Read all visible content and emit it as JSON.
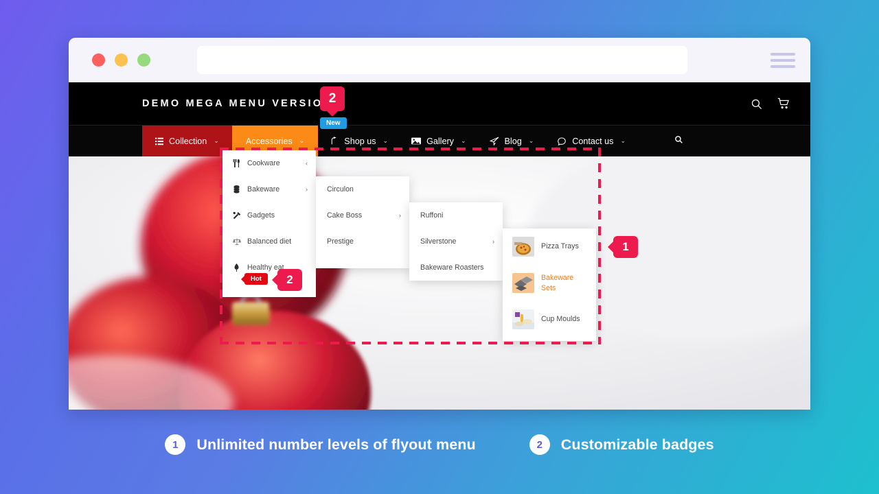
{
  "browser": {
    "traffic_lights": [
      "close-red",
      "minimize-yellow",
      "maximize-green"
    ],
    "url_value": "",
    "url_placeholder": "",
    "menu_icon": "hamburger-icon"
  },
  "site": {
    "logo_text": "DEMO MEGA MENU VERSION 2",
    "header_icons": [
      "search-icon",
      "cart-icon"
    ],
    "nav": [
      {
        "label": "Collection",
        "icon": "list-icon",
        "caret": "⌄",
        "state": "active-red"
      },
      {
        "label": "Accessories",
        "icon": "",
        "caret": "⌄",
        "state": "active-orange"
      },
      {
        "label": "Shop us",
        "icon": "share-icon",
        "caret": "⌄",
        "state": "default"
      },
      {
        "label": "Gallery",
        "icon": "image-icon",
        "caret": "⌄",
        "state": "default"
      },
      {
        "label": "Blog",
        "icon": "paperplane-icon",
        "caret": "⌄",
        "state": "default"
      },
      {
        "label": "Contact us",
        "icon": "comment-icon",
        "caret": "⌄",
        "state": "default"
      }
    ],
    "nav_search_icon": "search-icon"
  },
  "menu": {
    "level1": [
      {
        "label": "Cookware",
        "icon": "cutlery-icon",
        "arrow": "‹"
      },
      {
        "label": "Bakeware",
        "icon": "pans-icon",
        "arrow": "›"
      },
      {
        "label": "Gadgets",
        "icon": "gadgets-icon",
        "arrow": ""
      },
      {
        "label": "Balanced diet",
        "icon": "scales-icon",
        "arrow": ""
      },
      {
        "label": "Healthy eat",
        "icon": "leaf-icon",
        "arrow": ""
      }
    ],
    "level2": [
      {
        "label": "Circulon",
        "arrow": ""
      },
      {
        "label": "Cake Boss",
        "arrow": "›"
      },
      {
        "label": "Prestige",
        "arrow": ""
      }
    ],
    "level3": [
      {
        "label": "Ruffoni",
        "arrow": ""
      },
      {
        "label": "Silverstone",
        "arrow": "›"
      },
      {
        "label": "Bakeware Roasters",
        "arrow": ""
      }
    ],
    "level4": [
      {
        "label": "Pizza Trays",
        "thumb": "pizza-tray-thumb",
        "active": false
      },
      {
        "label": "Bakeware Sets",
        "thumb": "bakeware-sets-thumb",
        "active": true
      },
      {
        "label": "Cup Moulds",
        "thumb": "cup-moulds-thumb",
        "active": false
      }
    ]
  },
  "badges": {
    "new_label": "New",
    "hot_label": "Hot",
    "callout_top": "2",
    "callout_hot": "2",
    "callout_one": "1",
    "new_color": "#1f9ce4",
    "hot_color": "#e30613",
    "callout_color": "#ed1a4d"
  },
  "captions": [
    {
      "number": "1",
      "text": "Unlimited number levels of flyout menu"
    },
    {
      "number": "2",
      "text": "Customizable badges"
    }
  ],
  "colors": {
    "nav_collection": "#ae1317",
    "nav_accessories": "#fc8a16",
    "highlight_orange": "#f07c1b",
    "page_gradient_from": "#6f5cee",
    "page_gradient_to": "#1dc0ce"
  }
}
